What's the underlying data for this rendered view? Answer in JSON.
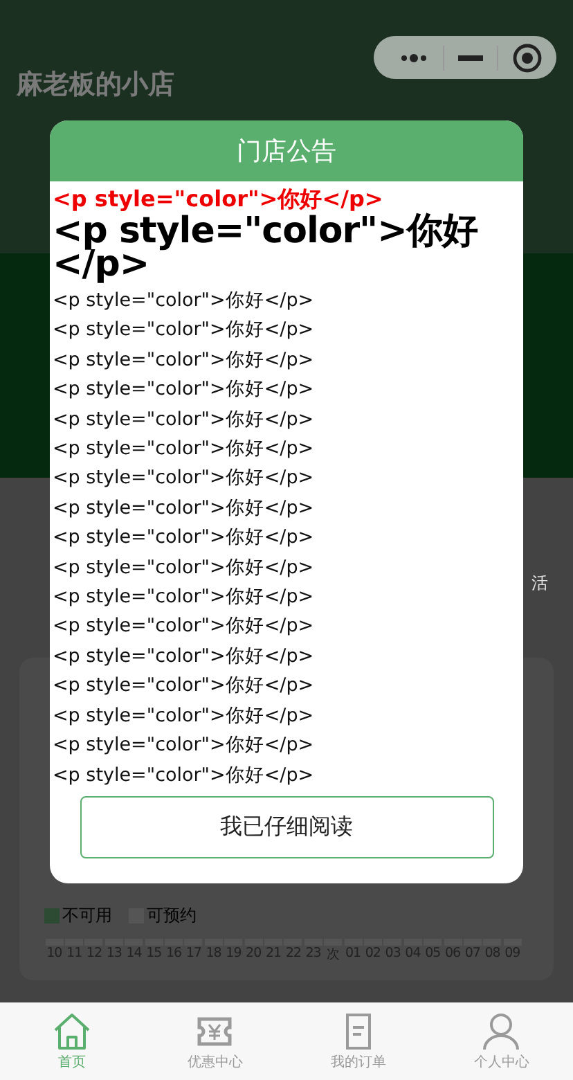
{
  "page": {
    "title": "麻老板的小店"
  },
  "side_label": "活",
  "legend": [
    {
      "label": "不可用",
      "color": "#2d4a32"
    },
    {
      "label": "可预约",
      "color": "#555555"
    }
  ],
  "hours": [
    "10",
    "11",
    "12",
    "13",
    "14",
    "15",
    "16",
    "17",
    "18",
    "19",
    "20",
    "21",
    "22",
    "23",
    "次",
    "01",
    "02",
    "03",
    "04",
    "05",
    "06",
    "07",
    "08",
    "09"
  ],
  "modal": {
    "title": "门店公告",
    "lines": [
      {
        "kind": "red",
        "text": "<p style=\"color\">你好</p>"
      },
      {
        "kind": "large",
        "text": "<p style=\"color\">你好</p>"
      },
      {
        "kind": "plain",
        "text": "<p style=\"color\">你好</p>"
      },
      {
        "kind": "plain",
        "text": "<p style=\"color\">你好</p>"
      },
      {
        "kind": "plain",
        "text": "<p style=\"color\">你好</p>"
      },
      {
        "kind": "plain",
        "text": "<p style=\"color\">你好</p>"
      },
      {
        "kind": "plain",
        "text": "<p style=\"color\">你好</p>"
      },
      {
        "kind": "plain",
        "text": "<p style=\"color\">你好</p>"
      },
      {
        "kind": "plain",
        "text": "<p style=\"color\">你好</p>"
      },
      {
        "kind": "plain",
        "text": "<p style=\"color\">你好</p>"
      },
      {
        "kind": "plain",
        "text": "<p style=\"color\">你好</p>"
      },
      {
        "kind": "plain",
        "text": "<p style=\"color\">你好</p>"
      },
      {
        "kind": "plain",
        "text": "<p style=\"color\">你好</p>"
      },
      {
        "kind": "plain",
        "text": "<p style=\"color\">你好</p>"
      },
      {
        "kind": "plain",
        "text": "<p style=\"color\">你好</p>"
      },
      {
        "kind": "plain",
        "text": "<p style=\"color\">你好</p>"
      },
      {
        "kind": "plain",
        "text": "<p style=\"color\">你好</p>"
      },
      {
        "kind": "plain",
        "text": "<p style=\"color\">你好</p>"
      },
      {
        "kind": "plain",
        "text": "<p style=\"color\">你好</p>"
      }
    ],
    "button": "我已仔细阅读"
  },
  "tabs": [
    {
      "label": "首页",
      "selected": true
    },
    {
      "label": "优惠中心",
      "selected": false
    },
    {
      "label": "我的订单",
      "selected": false
    },
    {
      "label": "个人中心",
      "selected": false
    }
  ]
}
